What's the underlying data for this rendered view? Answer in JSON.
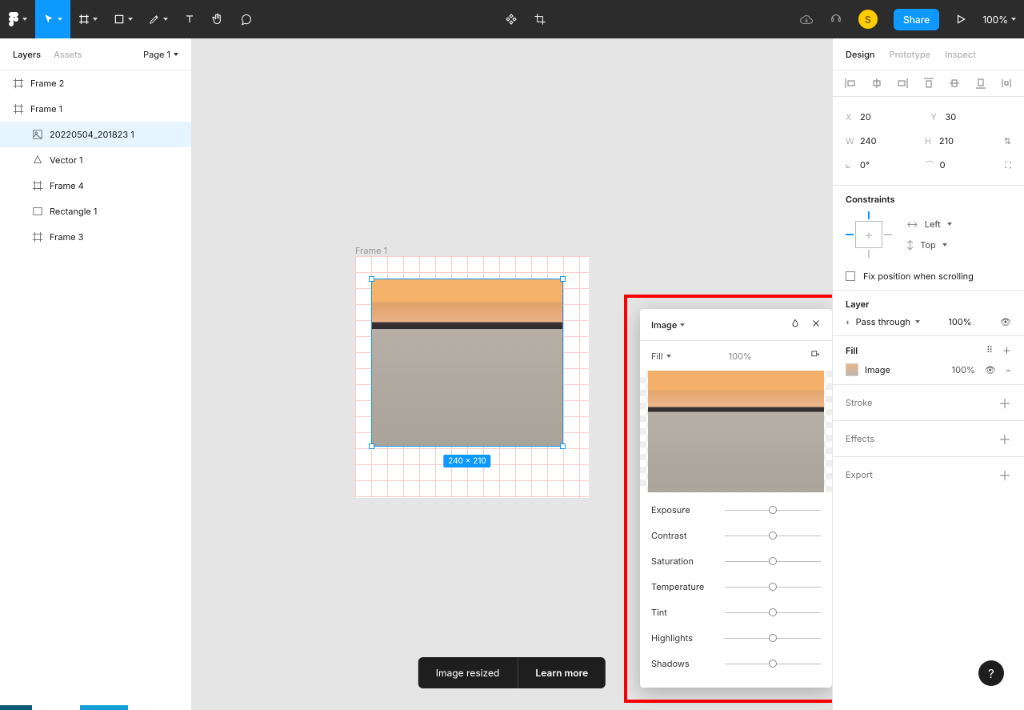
{
  "toolbar": {
    "share_label": "Share",
    "zoom_label": "100%",
    "avatar_initial": "S"
  },
  "left": {
    "tabs": {
      "layers": "Layers",
      "assets": "Assets"
    },
    "pages_label": "Page 1",
    "tree": [
      {
        "depth": 0,
        "icon": "frame",
        "label": "Frame 2"
      },
      {
        "depth": 0,
        "icon": "frame",
        "label": "Frame 1"
      },
      {
        "depth": 1,
        "icon": "image",
        "label": "20220504_201823 1",
        "selected": true
      },
      {
        "depth": 1,
        "icon": "vector",
        "label": "Vector 1"
      },
      {
        "depth": 1,
        "icon": "frame",
        "label": "Frame 4"
      },
      {
        "depth": 1,
        "icon": "rect",
        "label": "Rectangle 1"
      },
      {
        "depth": 1,
        "icon": "frame",
        "label": "Frame 3"
      }
    ]
  },
  "canvas": {
    "frame_label": "Frame 1",
    "size_badge": "240 × 210"
  },
  "popover": {
    "title": "Image",
    "mode_label": "Fill",
    "mode_value": "100%",
    "sliders": [
      "Exposure",
      "Contrast",
      "Saturation",
      "Temperature",
      "Tint",
      "Highlights",
      "Shadows"
    ]
  },
  "toast": {
    "message": "Image resized",
    "action": "Learn more"
  },
  "right": {
    "tabs": {
      "design": "Design",
      "prototype": "Prototype",
      "inspect": "Inspect"
    },
    "pos": {
      "x_label": "X",
      "x": "20",
      "y_label": "Y",
      "y": "30",
      "w_label": "W",
      "w": "240",
      "h_label": "H",
      "h": "210",
      "rot_label": "⟀",
      "rot": "0°",
      "rad_label": "⌒",
      "rad": "0"
    },
    "constraints_title": "Constraints",
    "constraint_h": "Left",
    "constraint_v": "Top",
    "fix_label": "Fix position when scrolling",
    "layer_title": "Layer",
    "blend_mode": "Pass through",
    "blend_opacity": "100%",
    "fill_title": "Fill",
    "fill_type": "Image",
    "fill_opacity": "100%",
    "stroke_title": "Stroke",
    "effects_title": "Effects",
    "export_title": "Export"
  }
}
